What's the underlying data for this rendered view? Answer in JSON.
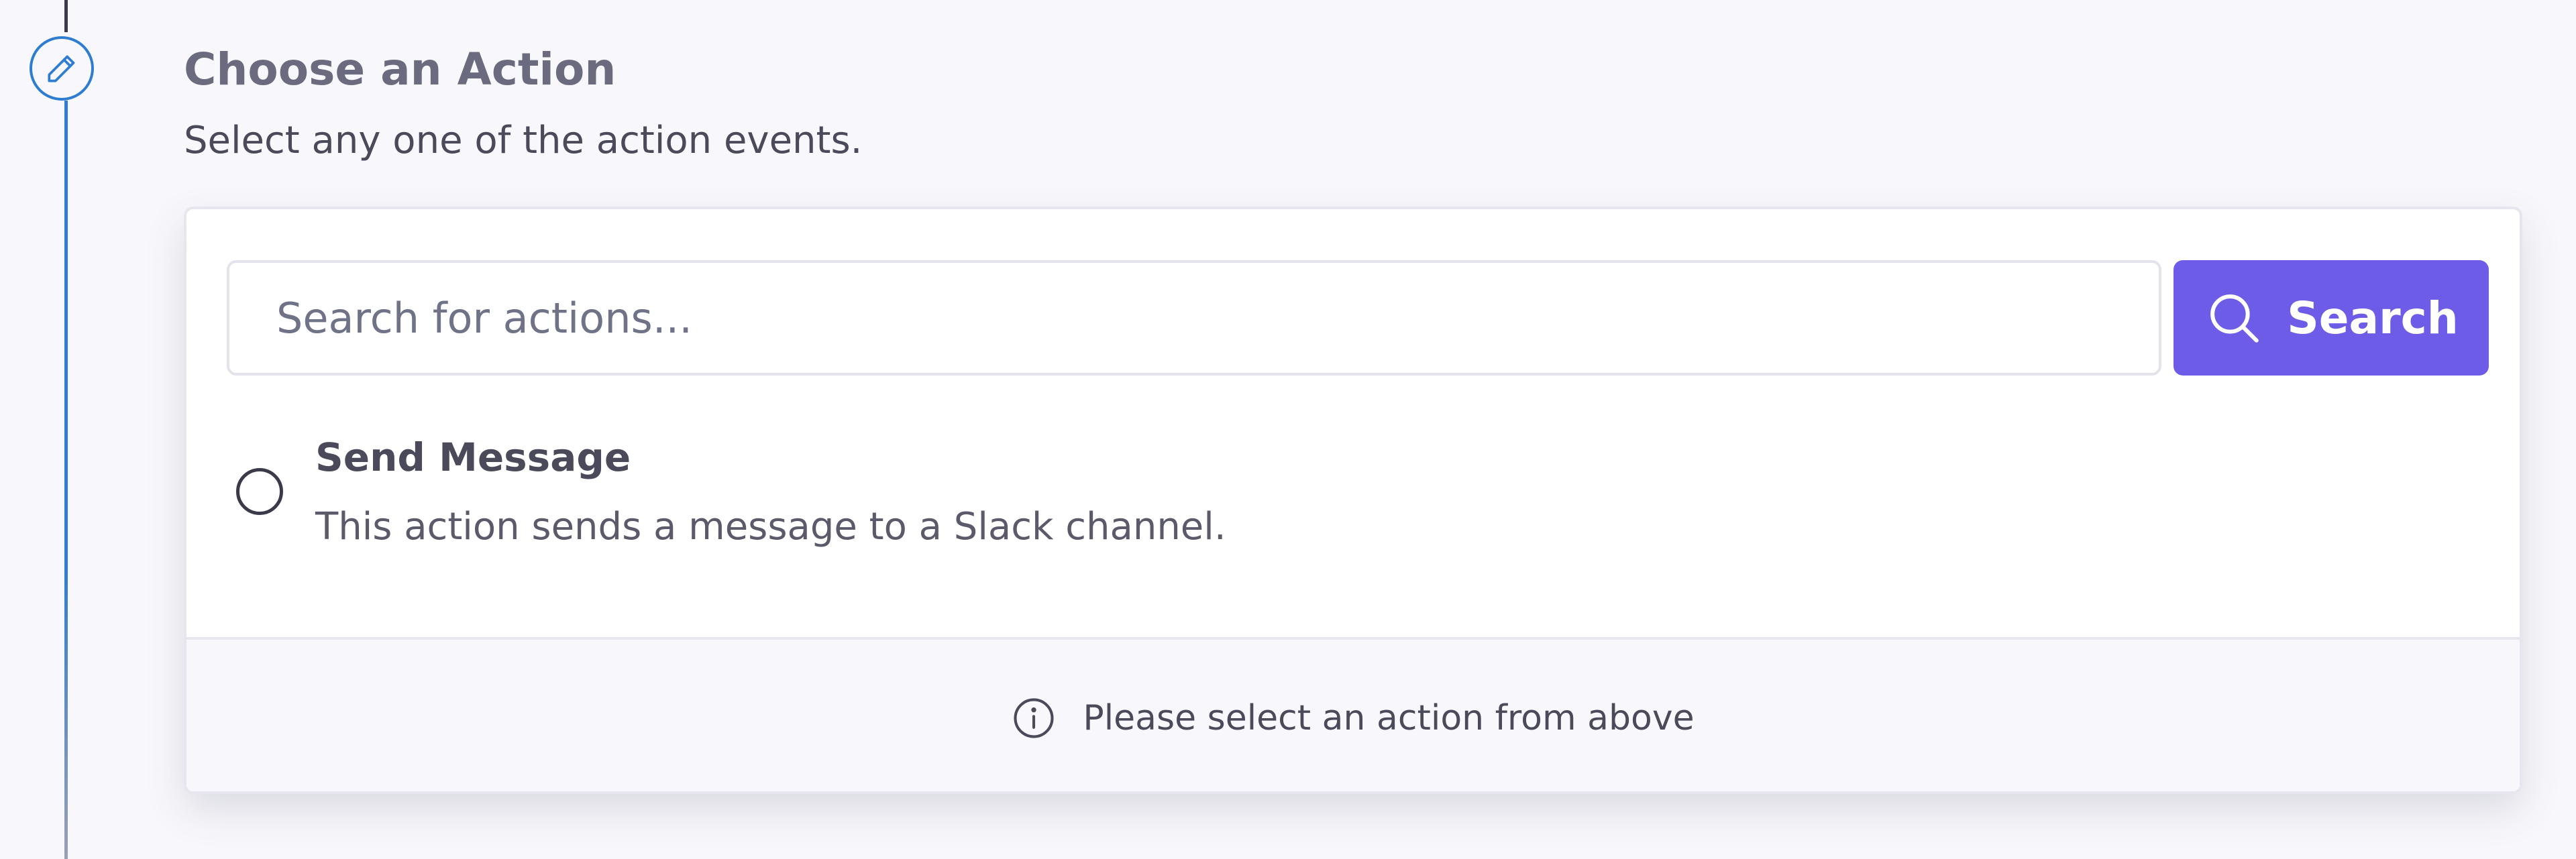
{
  "step": {
    "title": "Choose an Action",
    "subtitle": "Select any one of the action events.",
    "icon": "pencil-icon",
    "accent_color": "#2f7dd3"
  },
  "search": {
    "placeholder": "Search for actions...",
    "value": "",
    "button_label": "Search",
    "button_color": "#6c5ce7",
    "icon": "search-icon"
  },
  "actions": [
    {
      "title": "Send Message",
      "description": "This action sends a message to a Slack channel.",
      "selected": false
    }
  ],
  "footer": {
    "message": "Please select an action from above",
    "icon": "info-icon"
  }
}
